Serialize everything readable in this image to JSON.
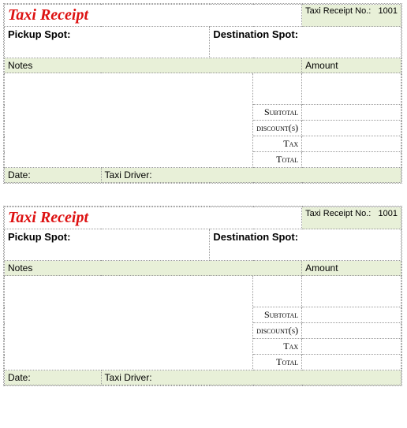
{
  "receipts": [
    {
      "title": "Taxi Receipt",
      "receipt_no_label": "Taxi Receipt No.:",
      "receipt_no_value": "1001",
      "pickup_label": "Pickup Spot:",
      "destination_label": "Destination Spot:",
      "notes_label": "Notes",
      "amount_label": "Amount",
      "subtotal_label": "Subtotal",
      "discount_label": "discount(s)",
      "tax_label": "Tax",
      "total_label": "Total",
      "date_label": "Date:",
      "driver_label": "Taxi Driver:"
    },
    {
      "title": "Taxi Receipt",
      "receipt_no_label": "Taxi Receipt No.:",
      "receipt_no_value": "1001",
      "pickup_label": "Pickup Spot:",
      "destination_label": "Destination Spot:",
      "notes_label": "Notes",
      "amount_label": "Amount",
      "subtotal_label": "Subtotal",
      "discount_label": "discount(s)",
      "tax_label": "Tax",
      "total_label": "Total",
      "date_label": "Date:",
      "driver_label": "Taxi Driver:"
    }
  ]
}
